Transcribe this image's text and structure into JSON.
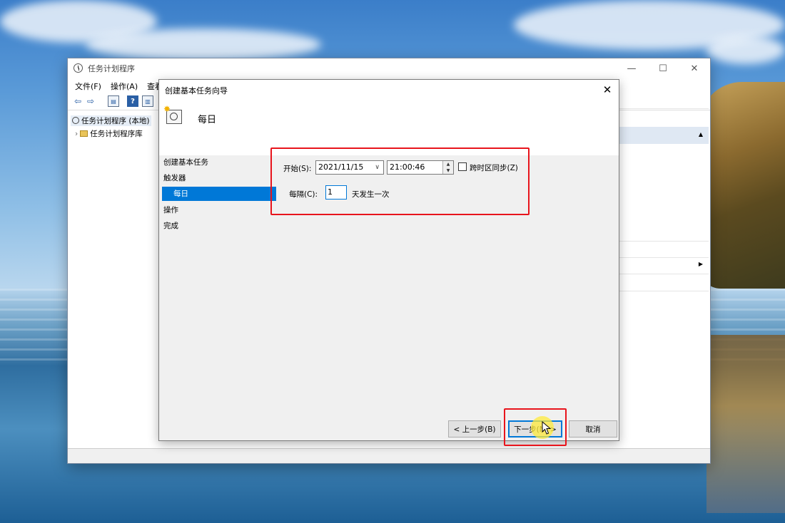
{
  "main_window": {
    "title": "任务计划程序",
    "menu": [
      "文件(F)",
      "操作(A)",
      "查看"
    ],
    "tree": {
      "root": "任务计划程序 (本地)",
      "child": "任务计划程序库"
    }
  },
  "dialog": {
    "title": "创建基本任务向导",
    "header_title": "每日",
    "steps": [
      "创建基本任务",
      "触发器",
      "每日",
      "操作",
      "完成"
    ],
    "start_label": "开始(S):",
    "start_date": "2021/11/15",
    "start_time": "21:00:46",
    "sync_label": "跨时区同步(Z)",
    "sync_checked": false,
    "interval_label": "每隔(C):",
    "interval_value": "1",
    "interval_suffix": "天发生一次",
    "back_label": "< 上一步(B)",
    "next_label": "下一步(N) >",
    "cancel_label": "取消"
  },
  "colors": {
    "accent": "#0078d7",
    "highlight_red": "#e8141c",
    "cursor_halo": "#ffeb3c"
  },
  "icons": [
    "clock-icon",
    "folder-icon",
    "back-arrow-icon",
    "forward-arrow-icon",
    "help-icon",
    "calendar-clock-icon",
    "close-icon",
    "minimize-icon",
    "maximize-icon",
    "cursor-icon"
  ]
}
